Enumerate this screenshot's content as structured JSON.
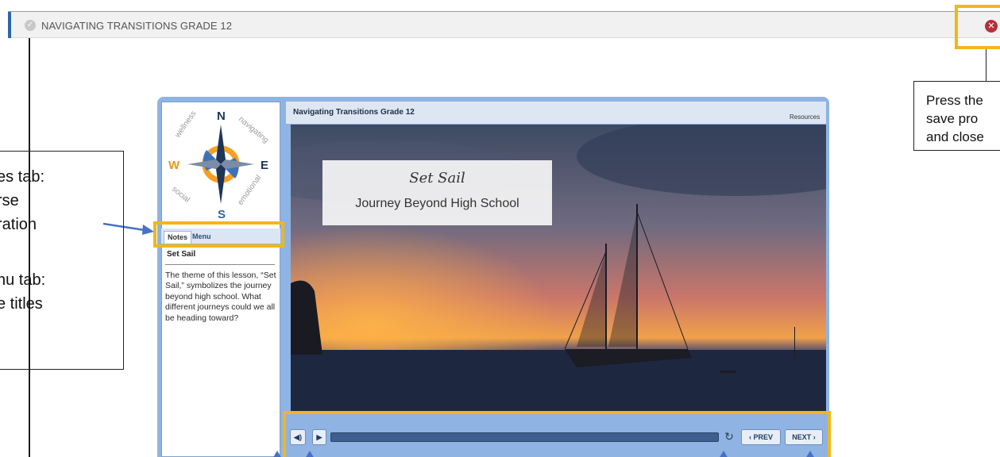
{
  "window": {
    "title": "NAVIGATING TRANSITIONS GRADE 12",
    "check_glyph": "✓",
    "close_glyph": "✕"
  },
  "player": {
    "course_title": "Navigating Transitions Grade 12",
    "resources_label": "Resources",
    "compass": {
      "n": "N",
      "s": "S",
      "e": "E",
      "w": "W",
      "words": [
        "wellness",
        "navigating",
        "social",
        "emotional"
      ]
    },
    "tabs": [
      {
        "label": "Notes",
        "active": true
      },
      {
        "label": "Menu",
        "active": false
      }
    ],
    "notes": {
      "heading": "Set Sail",
      "body": "The theme of this lesson, “Set Sail,” symbolizes the journey beyond high school. What different journeys could we all be heading toward?"
    },
    "slide": {
      "title": "Set Sail",
      "subtitle": "Journey Beyond High School"
    },
    "controls": {
      "volume_glyph": "◀)",
      "play_glyph": "▶",
      "replay_glyph": "↻",
      "prev_label": "‹ PREV",
      "next_label": "NEXT ›"
    }
  },
  "callouts": {
    "left_lines": [
      "es tab:",
      "rse",
      "ration",
      "nu tab:",
      "e titles"
    ],
    "right_lines": [
      "Press the",
      "save pro",
      "and close"
    ]
  },
  "colors": {
    "highlight": "#f2b619",
    "player_frame": "#8fb3e3",
    "arrow": "#4472c4",
    "close": "#b2323a"
  }
}
